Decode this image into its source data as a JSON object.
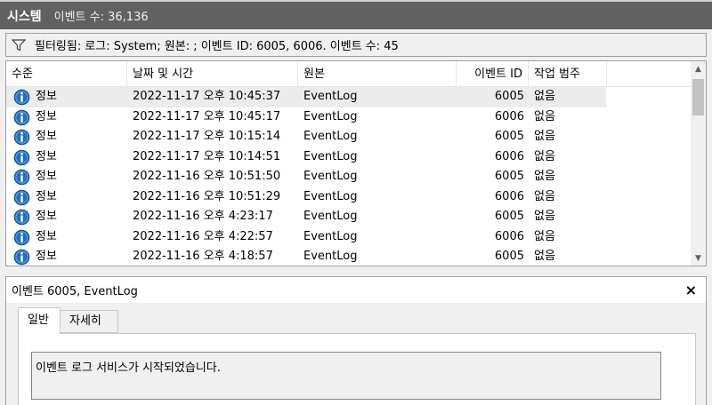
{
  "titlebar": {
    "name": "시스템",
    "count": "이벤트 수: 36,136"
  },
  "filter": {
    "text": "필터링됨: 로그: System; 원본: ; 이벤트 ID: 6005, 6006. 이벤트 수: 45",
    "icon": "filter-icon"
  },
  "columns": {
    "level": "수준",
    "datetime": "날짜 및 시간",
    "source": "원본",
    "event_id": "이벤트 ID",
    "category": "작업 범주"
  },
  "rows": [
    {
      "level": "정보",
      "datetime": "2022-11-17 오후 10:45:37",
      "source": "EventLog",
      "event_id": "6005",
      "category": "없음"
    },
    {
      "level": "정보",
      "datetime": "2022-11-17 오후 10:45:17",
      "source": "EventLog",
      "event_id": "6006",
      "category": "없음"
    },
    {
      "level": "정보",
      "datetime": "2022-11-17 오후 10:15:14",
      "source": "EventLog",
      "event_id": "6005",
      "category": "없음"
    },
    {
      "level": "정보",
      "datetime": "2022-11-17 오후 10:14:51",
      "source": "EventLog",
      "event_id": "6006",
      "category": "없음"
    },
    {
      "level": "정보",
      "datetime": "2022-11-16 오후 10:51:50",
      "source": "EventLog",
      "event_id": "6005",
      "category": "없음"
    },
    {
      "level": "정보",
      "datetime": "2022-11-16 오후 10:51:29",
      "source": "EventLog",
      "event_id": "6006",
      "category": "없음"
    },
    {
      "level": "정보",
      "datetime": "2022-11-16 오후 4:23:17",
      "source": "EventLog",
      "event_id": "6005",
      "category": "없음"
    },
    {
      "level": "정보",
      "datetime": "2022-11-16 오후 4:22:57",
      "source": "EventLog",
      "event_id": "6006",
      "category": "없음"
    },
    {
      "level": "정보",
      "datetime": "2022-11-16 오후 4:18:57",
      "source": "EventLog",
      "event_id": "6005",
      "category": "없음"
    }
  ],
  "detail": {
    "title": "이벤트 6005, EventLog",
    "close": "×",
    "tabs": {
      "general": "일반",
      "details": "자세히"
    },
    "description": "이벤트 로그 서비스가 시작되었습니다."
  },
  "colors": {
    "titlebar": "#616161",
    "selected_row": "#ececec",
    "info_icon": "#1f6fc5"
  }
}
